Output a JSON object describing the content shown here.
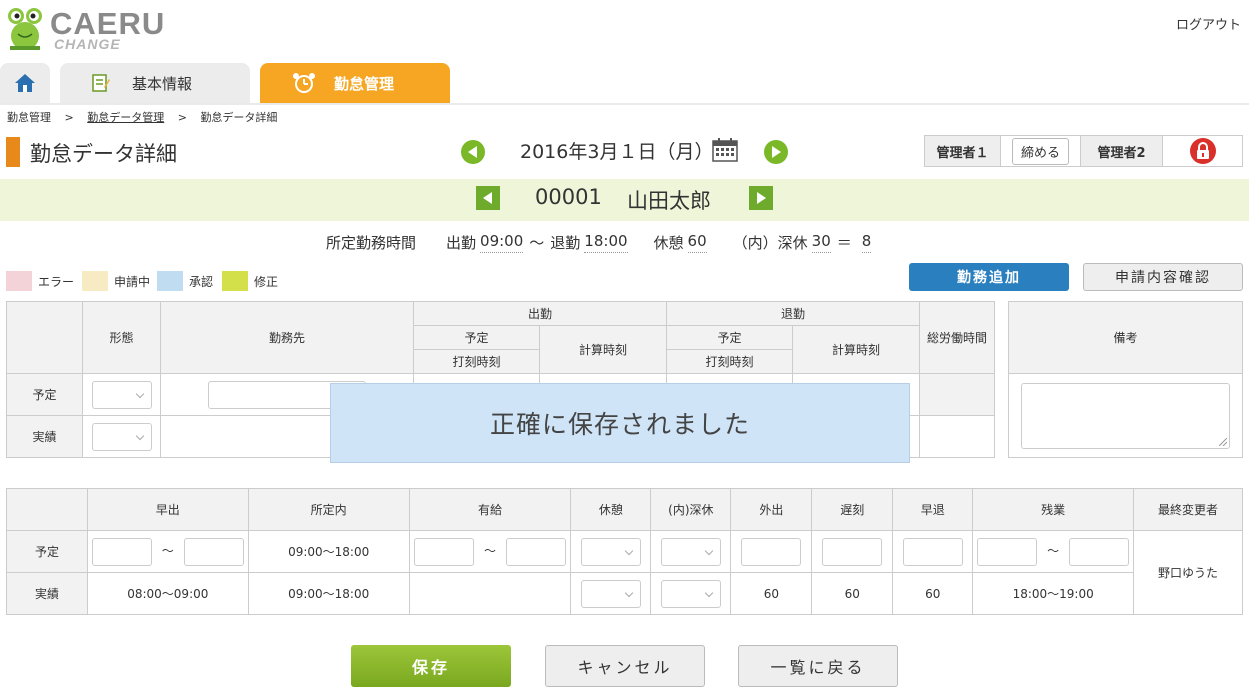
{
  "header": {
    "logo_text": "CAERU",
    "logo_sub": "CHANGE",
    "logout": "ログアウト"
  },
  "tabs": [
    {
      "label": ""
    },
    {
      "label": "基本情報"
    },
    {
      "label": "勤怠管理"
    }
  ],
  "breadcrumb": [
    "勤怠管理",
    ">",
    "勤怠データ管理",
    ">",
    "勤怠データ詳細"
  ],
  "page_title": "勤怠データ詳細",
  "date": "2016年3月１日（月）",
  "approval": {
    "admin1": "管理者１",
    "close": "締める",
    "admin2": "管理者2"
  },
  "employee": {
    "id": "00001",
    "name": "山田太郎"
  },
  "work_hours": {
    "label": "所定勤務時間",
    "start_label": "出勤",
    "start": "09:00",
    "tilde": "〜",
    "end_label": "退勤",
    "end": "18:00",
    "break_label": "休憩",
    "break": "60",
    "night_label": "（内）深休",
    "night": "30",
    "eq": "＝",
    "result": "8"
  },
  "legend": [
    {
      "label": "エラー",
      "color": "#f4d3d8"
    },
    {
      "label": "申請中",
      "color": "#f7ebc3"
    },
    {
      "label": "承認",
      "color": "#bfdcf0"
    },
    {
      "label": "修正",
      "color": "#d4e04a"
    }
  ],
  "buttons": {
    "add": "勤務追加",
    "check": "申請内容確認",
    "save": "保存",
    "cancel": "キャンセル",
    "back": "一覧に戻る"
  },
  "table1": {
    "h_form": "形態",
    "h_dest": "勤務先",
    "h_in": "出勤",
    "h_out": "退勤",
    "h_plan": "予定",
    "h_stamp": "打刻時刻",
    "h_calc": "計算時刻",
    "h_total": "総労働時間",
    "r_plan": "予定",
    "r_actual": "実績"
  },
  "remarks": {
    "header": "備考"
  },
  "toast": "正確に保存されました",
  "table2": {
    "headers": [
      "早出",
      "所定内",
      "有給",
      "休憩",
      "(内)深休",
      "外出",
      "遅刻",
      "早退",
      "残業",
      "最終変更者"
    ],
    "r_plan": "予定",
    "r_actual": "実績",
    "tilde": "〜",
    "plan_scheduled": "09:00〜18:00",
    "actual_early": "08:00〜09:00",
    "actual_scheduled": "09:00〜18:00",
    "actual_out": "60",
    "actual_late": "60",
    "actual_leave": "60",
    "actual_overtime": "18:00〜19:00",
    "last_editor": "野口ゆうた"
  }
}
